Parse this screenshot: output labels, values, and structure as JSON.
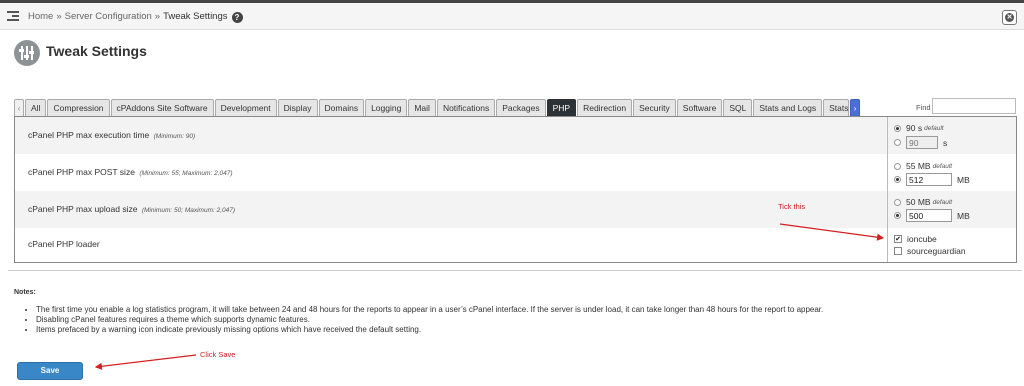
{
  "breadcrumb": {
    "items": [
      "Home",
      "Server Configuration",
      "Tweak Settings"
    ],
    "separator": "»",
    "help_icon": "question-circle-icon"
  },
  "header": {
    "title": "Tweak Settings",
    "icon": "sliders-icon",
    "close_icon": "close-icon"
  },
  "tabs": {
    "scroll_left": "‹",
    "items": [
      "All",
      "Compression",
      "cPAddons Site Software",
      "Development",
      "Display",
      "Domains",
      "Logging",
      "Mail",
      "Notifications",
      "Packages",
      "PHP",
      "Redirection",
      "Security",
      "Software",
      "SQL",
      "Stats and Logs",
      "Stats"
    ],
    "active": "PHP",
    "scroll_right": "›",
    "find_label": "Find",
    "find_value": ""
  },
  "settings": [
    {
      "label": "cPanel PHP max execution time",
      "hint": "(Minimum: 90)",
      "default_value": "90",
      "default_unit": "s",
      "default_tag": "default",
      "custom_value": "90",
      "custom_unit": "s",
      "selected": "default"
    },
    {
      "label": "cPanel PHP max POST size",
      "hint": "(Minimum: 55; Maximum: 2,047)",
      "default_value": "55",
      "default_unit": "MB",
      "default_tag": "default",
      "custom_value": "512",
      "custom_unit": "MB",
      "selected": "custom"
    },
    {
      "label": "cPanel PHP max upload size",
      "hint": "(Minimum: 50; Maximum: 2,047)",
      "default_value": "50",
      "default_unit": "MB",
      "default_tag": "default",
      "custom_value": "500",
      "custom_unit": "MB",
      "selected": "custom"
    },
    {
      "label": "cPanel PHP loader",
      "options": [
        {
          "label": "ioncube",
          "checked": true
        },
        {
          "label": "sourceguardian",
          "checked": false
        }
      ]
    }
  ],
  "annotations": {
    "tick": "Tick this",
    "save": "Click Save",
    "color": "#d32020"
  },
  "notes": {
    "title": "Notes:",
    "items": [
      "The first time you enable a log statistics program, it will take between 24 and 48 hours for the reports to appear in a user’s cPanel interface. If the server is under load, it can take longer than 48 hours for the report to appear.",
      "Disabling cPanel features requires a theme which supports dynamic features.",
      "Items prefaced by a warning icon indicate previously missing options which have received the default setting."
    ]
  },
  "save_button": {
    "label": "Save",
    "color": "#3a87c8"
  }
}
